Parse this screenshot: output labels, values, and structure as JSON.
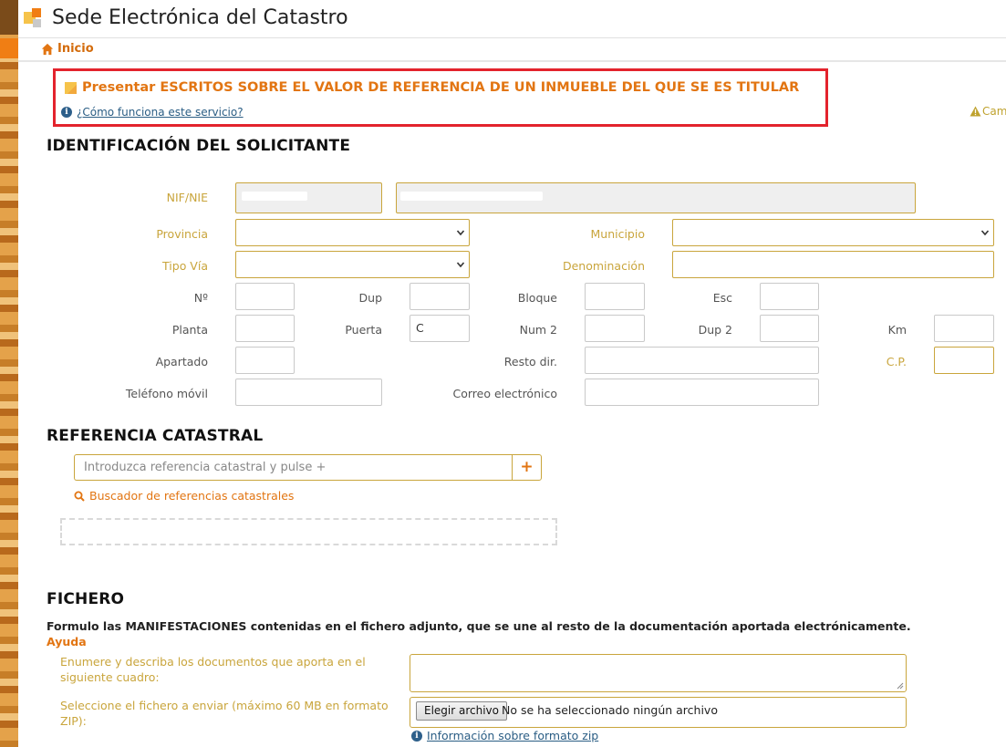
{
  "header": {
    "app_title": "Sede Electrónica del Catastro"
  },
  "breadcrumb": {
    "home_label": "Inicio"
  },
  "service": {
    "title": "Presentar ESCRITOS SOBRE EL VALOR DE REFERENCIA DE UN INMUEBLE DEL QUE SE ES TITULAR",
    "help_link": "¿Cómo funciona este servicio?",
    "alert_link": "Cam"
  },
  "applicant": {
    "heading": "IDENTIFICACIÓN DEL SOLICITANTE",
    "labels": {
      "nif": "NIF/NIE",
      "provincia": "Provincia",
      "municipio": "Municipio",
      "tipo_via": "Tipo Vía",
      "denominacion": "Denominación",
      "numero": "Nº",
      "dup": "Dup",
      "bloque": "Bloque",
      "esc": "Esc",
      "planta": "Planta",
      "puerta": "Puerta",
      "num2": "Num 2",
      "dup2": "Dup 2",
      "km": "Km",
      "apartado": "Apartado",
      "resto_dir": "Resto dir.",
      "cp": "C.P.",
      "telefono": "Teléfono móvil",
      "correo": "Correo electrónico"
    },
    "values": {
      "puerta": "C"
    }
  },
  "cadastral": {
    "heading": "REFERENCIA CATASTRAL",
    "input_placeholder": "Introduzca referencia catastral y pulse +",
    "add_label": "+",
    "finder_link": "Buscador de referencias catastrales"
  },
  "file": {
    "heading": "FICHERO",
    "manifest_text": "Formulo las MANIFESTACIONES contenidas en el fichero adjunto, que se une al resto de la documentación aportada electrónicamente.",
    "help_label": "Ayuda",
    "docs_label": "Enumere y describa los documentos que aporta en el siguiente cuadro:",
    "select_label": "Seleccione el fichero a enviar (máximo 60 MB en formato ZIP):",
    "choose_button": "Elegir archivo",
    "no_file_text": "No se ha seleccionado ningún archivo",
    "zip_info_link": "Información sobre formato zip"
  },
  "colors": {
    "accent": "#e27512",
    "required": "#c9a53c",
    "highlight_border": "#e3232d",
    "link": "#2a5d84"
  }
}
